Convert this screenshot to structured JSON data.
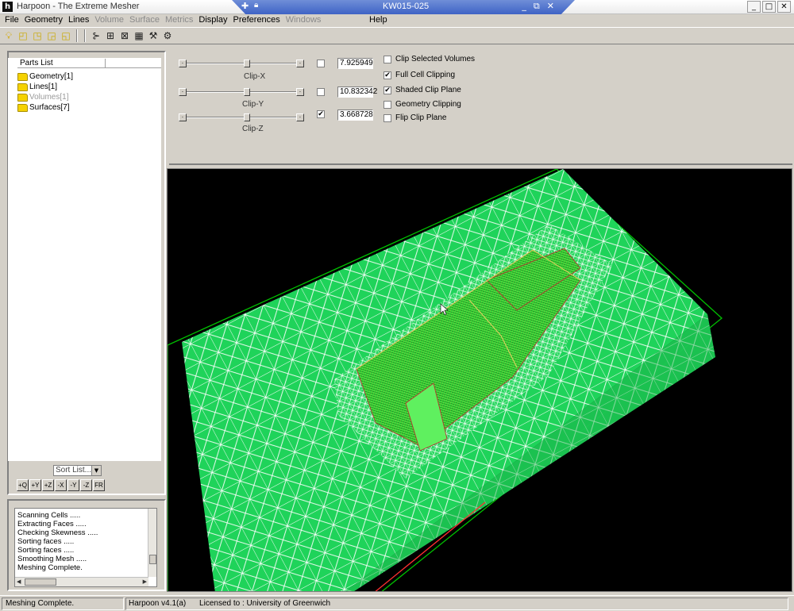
{
  "window": {
    "title": "Harpoon - The Extreme Mesher",
    "icon": "app-logo-icon",
    "controls": [
      "_",
      "□",
      "✕"
    ]
  },
  "remote_session": {
    "title": "KW015-025",
    "controls": [
      "_",
      "⧉",
      "✕"
    ]
  },
  "menu": {
    "items": [
      {
        "label": "File",
        "enabled": true
      },
      {
        "label": "Geometry",
        "enabled": true
      },
      {
        "label": "Lines",
        "enabled": true
      },
      {
        "label": "Volume",
        "enabled": false
      },
      {
        "label": "Surface",
        "enabled": false
      },
      {
        "label": "Metrics",
        "enabled": false
      },
      {
        "label": "Display",
        "enabled": true
      },
      {
        "label": "Preferences",
        "enabled": true
      },
      {
        "label": "Windows",
        "enabled": false
      }
    ],
    "help": "Help"
  },
  "toolbar": {
    "icons": [
      "lightbulb-icon",
      "cube-icon",
      "cube-icon",
      "cube-icon",
      "cube-icon",
      "node-icon",
      "mesh-icon",
      "grid-icon",
      "tools-icon",
      "tools-icon"
    ]
  },
  "parts": {
    "header": "Parts List",
    "items": [
      {
        "label": "Geometry[1]",
        "enabled": true
      },
      {
        "label": "Lines[1]",
        "enabled": true
      },
      {
        "label": "Volumes[1]",
        "enabled": false
      },
      {
        "label": "Surfaces[7]",
        "enabled": true
      }
    ],
    "sort": {
      "value": "Sort List..."
    },
    "axis_buttons": [
      "+Q",
      "+Y",
      "+Z",
      "-X",
      "-Y",
      "-Z",
      "FR"
    ]
  },
  "log": {
    "lines": [
      "Scanning Cells .....",
      "Extracting Faces .....",
      "Checking Skewness .....",
      "Sorting faces .....",
      "Sorting faces .....",
      "Smoothing Mesh .....",
      "Meshing Complete."
    ]
  },
  "clip": {
    "x": {
      "label": "Clip-X",
      "value": "7.925949",
      "checked": false,
      "level": 0.55
    },
    "y": {
      "label": "Clip-Y",
      "value": "10.832342",
      "checked": false,
      "level": 0.55
    },
    "z": {
      "label": "Clip-Z",
      "value": "3.668728",
      "checked": true,
      "level": 0.55
    },
    "options": [
      {
        "label": "Clip Selected Volumes",
        "checked": false
      },
      {
        "label": "Full Cell Clipping",
        "checked": true
      },
      {
        "label": "Shaded Clip Plane",
        "checked": true
      },
      {
        "label": "Geometry Clipping",
        "checked": false
      },
      {
        "label": "Flip Clip Plane",
        "checked": false
      }
    ]
  },
  "viewport": {
    "background": "#000000",
    "mesh_color": "#1fd35a",
    "wire_color": "#ffffff",
    "box_color": "#00c000",
    "part_color": "#3fe03f",
    "edge_color": "#ff3030"
  },
  "status": {
    "message": "Meshing Complete.",
    "version": "Harpoon v4.1(a)",
    "license": "Licensed to : University of Greenwich"
  }
}
